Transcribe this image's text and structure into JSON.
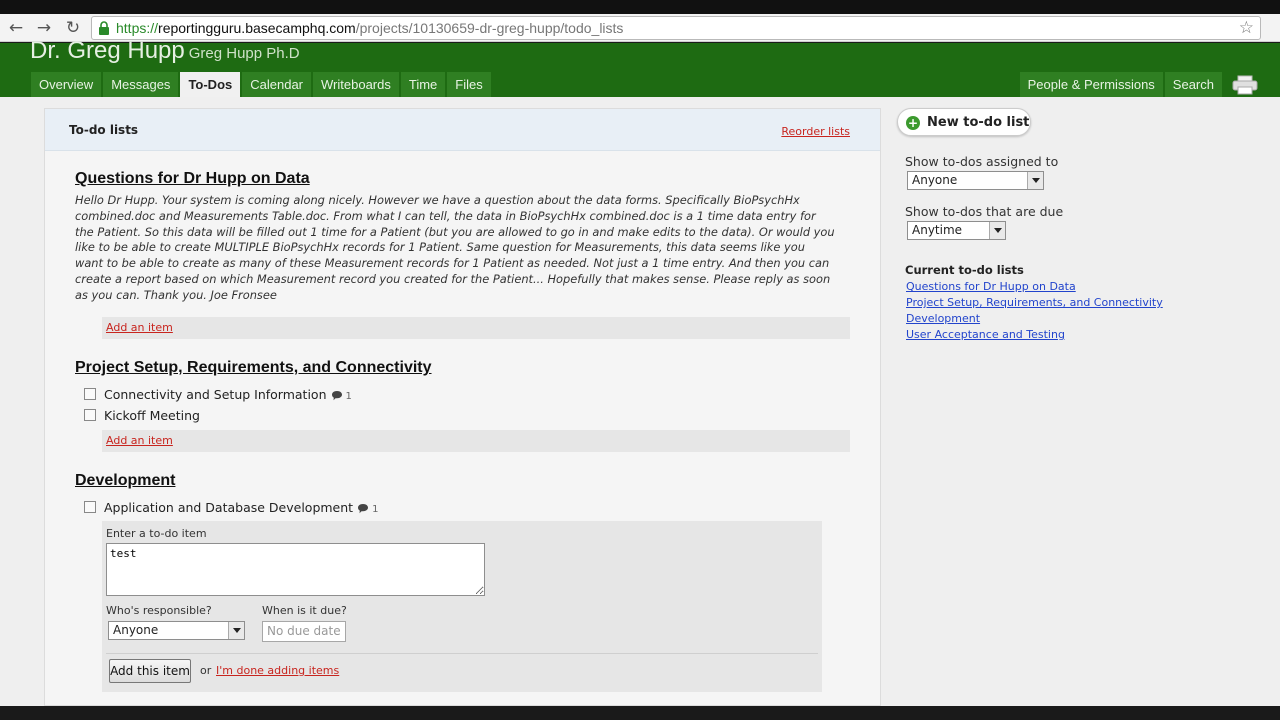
{
  "browser": {
    "url_scheme": "https://",
    "url_host": "reportingguru.basecamphq.com",
    "url_path": "/projects/10130659-dr-greg-hupp/todo_lists"
  },
  "header": {
    "title": "Dr. Greg Hupp",
    "subtitle": "Greg Hupp Ph.D",
    "tabs": [
      "Overview",
      "Messages",
      "To-Dos",
      "Calendar",
      "Writeboards",
      "Time",
      "Files"
    ],
    "right_tabs": [
      "People & Permissions",
      "Search"
    ]
  },
  "main": {
    "heading": "To-do lists",
    "reorder_label": "Reorder lists",
    "lists": [
      {
        "title": "Questions for Dr Hupp on Data",
        "description": "Hello Dr Hupp. Your system is coming along nicely. However we have a question about the data forms. Specifically BioPsychHx combined.doc and Measurements Table.doc. From what I can tell, the data in BioPsychHx combined.doc is a 1 time data entry for the Patient. So this data will be filled out 1 time for a Patient (but you are allowed to go in and make edits to the data). Or would you like to be able to create MULTIPLE BioPsychHx records for 1 Patient. Same question for Measurements, this data seems like you want to be able to create as many of these Measurement records for 1 Patient as needed. Not just a 1 time entry. And then you can create a report based on which Measurement record you created for the Patient... Hopefully that makes sense. Please reply as soon as you can. Thank you. Joe Fronsee",
        "add_label": "Add an item"
      },
      {
        "title": "Project Setup, Requirements, and Connectivity",
        "items": [
          {
            "text": "Connectivity and Setup Information",
            "comments": "1"
          },
          {
            "text": "Kickoff Meeting",
            "comments": ""
          }
        ],
        "add_label": "Add an item"
      },
      {
        "title": "Development",
        "items": [
          {
            "text": "Application and Database Development",
            "comments": "1"
          }
        ]
      }
    ],
    "form": {
      "enter_label": "Enter a to-do item",
      "textarea_value": "test",
      "responsible_label": "Who's responsible?",
      "responsible_value": "Anyone",
      "due_label": "When is it due?",
      "due_placeholder": "No due date",
      "add_button": "Add this item",
      "or_text": "or",
      "done_link": "I'm done adding items"
    }
  },
  "sidebar": {
    "new_list_label": "New to-do list",
    "assigned_label": "Show to-dos assigned to",
    "assigned_value": "Anyone",
    "due_label": "Show to-dos that are due",
    "due_value": "Anytime",
    "current_title": "Current to-do lists",
    "current_lists": [
      "Questions for Dr Hupp on Data",
      "Project Setup, Requirements, and Connectivity",
      "Development",
      "User Acceptance and Testing"
    ]
  },
  "colors": {
    "header_green": "#1e6b12",
    "link_red": "#c8251f",
    "link_blue": "#2244cc"
  }
}
